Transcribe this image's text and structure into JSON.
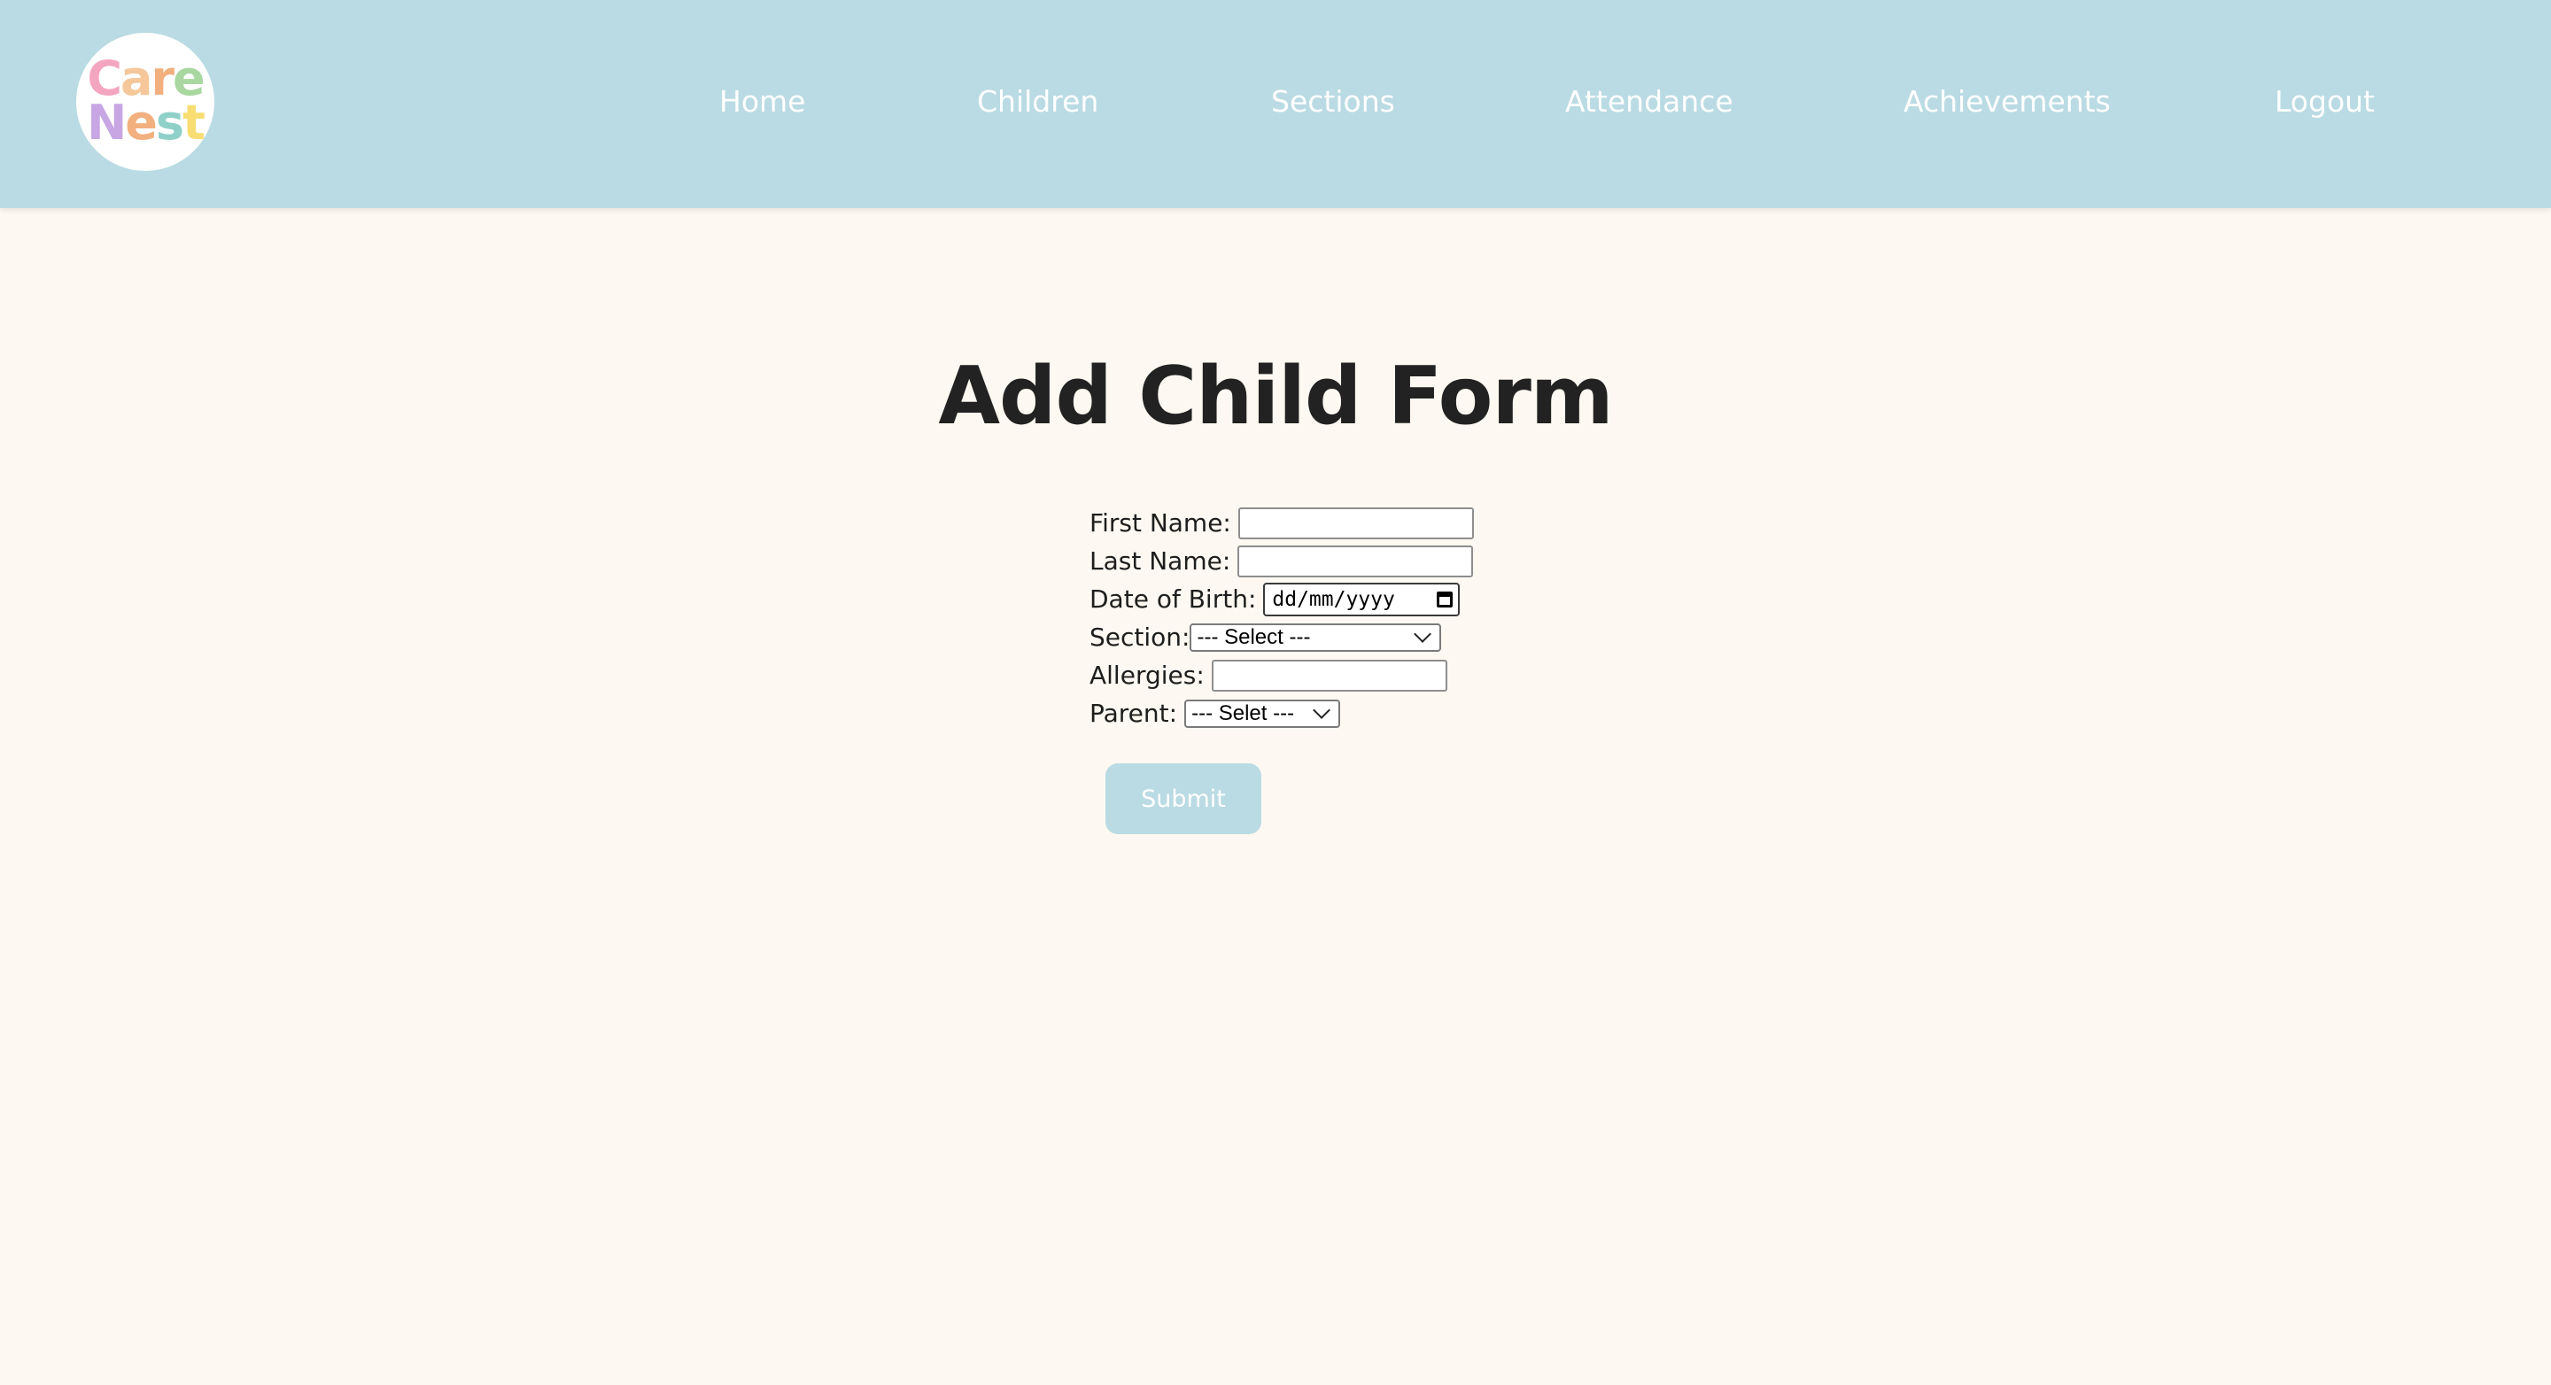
{
  "brand": {
    "logo_line1": "Care",
    "logo_line2": "Nest",
    "logo_colors": [
      "#f4a6c1",
      "#f6c79a",
      "#f3b07f",
      "#a8d8a0",
      "#c7a6e3",
      "#f3b07f",
      "#8fd0c9",
      "#f7dd72"
    ]
  },
  "nav": {
    "items": [
      "Home",
      "Children",
      "Sections",
      "Attendance",
      "Achievements",
      "Logout"
    ]
  },
  "page": {
    "title": "Add Child Form"
  },
  "form": {
    "first_name_label": "First Name:",
    "first_name_value": "",
    "last_name_label": "Last Name:",
    "last_name_value": "",
    "dob_label": "Date of Birth:",
    "dob_placeholder": "dd/mm/yyyy",
    "section_label": "Section:",
    "section_selected": "--- Select ---",
    "allergies_label": "Allergies:",
    "allergies_value": "",
    "parent_label": "Parent:",
    "parent_selected": "--- Selet ---",
    "submit_label": "Submit"
  },
  "colors": {
    "header_bg": "#badbe3",
    "page_bg": "#fdf9f2",
    "title_text": "#222222",
    "button_bg": "#badbe3",
    "button_text": "#ffffff"
  }
}
